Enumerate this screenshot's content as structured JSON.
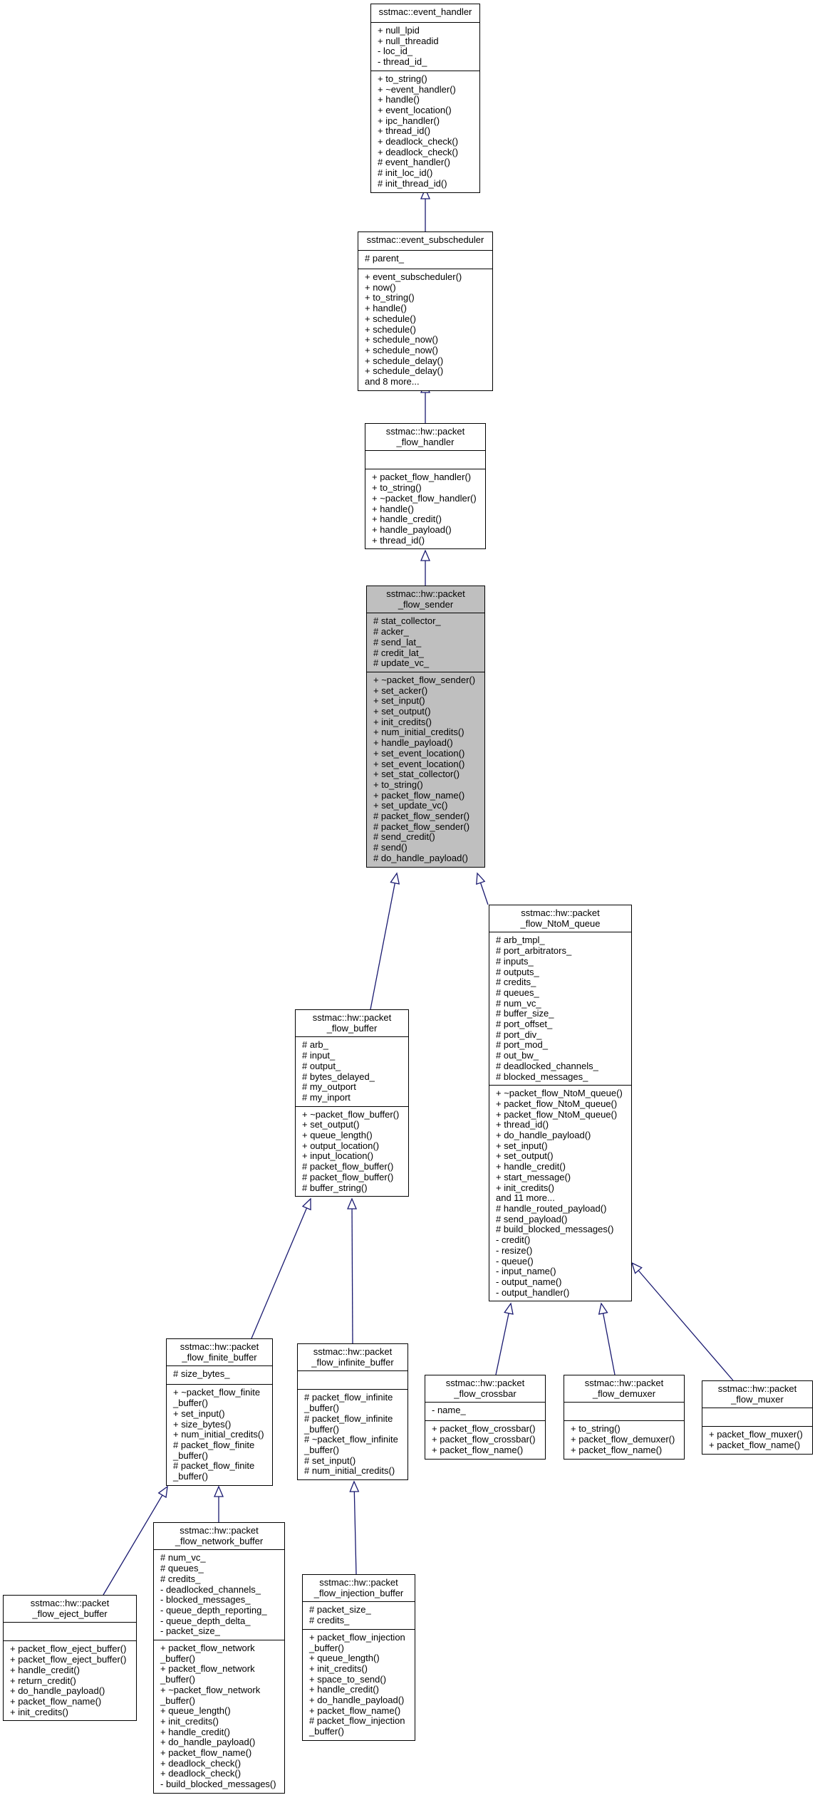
{
  "colors": {
    "edge": "#191970",
    "highlight_fill": "#bfbfbf",
    "box_fill": "#ffffff"
  },
  "classes": [
    {
      "title": [
        "sstmac::event_handler"
      ],
      "attributes": [
        "+ null_lpid",
        "+ null_threadid",
        "- loc_id_",
        "- thread_id_"
      ],
      "methods": [
        "+ to_string()",
        "+ ~event_handler()",
        "+ handle()",
        "+ event_location()",
        "+ ipc_handler()",
        "+ thread_id()",
        "+ deadlock_check()",
        "+ deadlock_check()",
        "# event_handler()",
        "# init_loc_id()",
        "# init_thread_id()"
      ]
    },
    {
      "title": [
        "sstmac::event_subscheduler"
      ],
      "attributes": [
        "# parent_"
      ],
      "methods": [
        "+ event_subscheduler()",
        "+ now()",
        "+ to_string()",
        "+ handle()",
        "+ schedule()",
        "+ schedule()",
        "+ schedule_now()",
        "+ schedule_now()",
        "+ schedule_delay()",
        "+ schedule_delay()",
        "and 8 more..."
      ]
    },
    {
      "title": [
        "sstmac::hw::packet",
        "_flow_handler"
      ],
      "attributes": [],
      "methods": [
        "+ packet_flow_handler()",
        "+ to_string()",
        "+ ~packet_flow_handler()",
        "+ handle()",
        "+ handle_credit()",
        "+ handle_payload()",
        "+ thread_id()"
      ]
    },
    {
      "title": [
        "sstmac::hw::packet",
        "_flow_sender"
      ],
      "highlighted": true,
      "attributes": [
        "# stat_collector_",
        "# acker_",
        "# send_lat_",
        "# credit_lat_",
        "# update_vc_"
      ],
      "methods": [
        "+ ~packet_flow_sender()",
        "+ set_acker()",
        "+ set_input()",
        "+ set_output()",
        "+ init_credits()",
        "+ num_initial_credits()",
        "+ handle_payload()",
        "+ set_event_location()",
        "+ set_event_location()",
        "+ set_stat_collector()",
        "+ to_string()",
        "+ packet_flow_name()",
        "+ set_update_vc()",
        "# packet_flow_sender()",
        "# packet_flow_sender()",
        "# send_credit()",
        "# send()",
        "# do_handle_payload()"
      ]
    },
    {
      "title": [
        "sstmac::hw::packet",
        "_flow_NtoM_queue"
      ],
      "attributes": [
        "# arb_tmpl_",
        "# port_arbitrators_",
        "# inputs_",
        "# outputs_",
        "# credits_",
        "# queues_",
        "# num_vc_",
        "# buffer_size_",
        "# port_offset_",
        "# port_div_",
        "# port_mod_",
        "# out_bw_",
        "# deadlocked_channels_",
        "# blocked_messages_"
      ],
      "methods": [
        "+ ~packet_flow_NtoM_queue()",
        "+ packet_flow_NtoM_queue()",
        "+ packet_flow_NtoM_queue()",
        "+ thread_id()",
        "+ do_handle_payload()",
        "+ set_input()",
        "+ set_output()",
        "+ handle_credit()",
        "+ start_message()",
        "+ init_credits()",
        "and 11 more...",
        "# handle_routed_payload()",
        "# send_payload()",
        "# build_blocked_messages()",
        "- credit()",
        "- resize()",
        "- queue()",
        "- input_name()",
        "- output_name()",
        "- output_handler()"
      ]
    },
    {
      "title": [
        "sstmac::hw::packet",
        "_flow_buffer"
      ],
      "attributes": [
        "# arb_",
        "# input_",
        "# output_",
        "# bytes_delayed_",
        "# my_outport",
        "# my_inport"
      ],
      "methods": [
        "+ ~packet_flow_buffer()",
        "+ set_output()",
        "+ queue_length()",
        "+ output_location()",
        "+ input_location()",
        "# packet_flow_buffer()",
        "# packet_flow_buffer()",
        "# buffer_string()"
      ]
    },
    {
      "title": [
        "sstmac::hw::packet",
        "_flow_finite_buffer"
      ],
      "attributes": [
        "# size_bytes_"
      ],
      "methods": [
        "+ ~packet_flow_finite",
        "_buffer()",
        "+ set_input()",
        "+ size_bytes()",
        "+ num_initial_credits()",
        "# packet_flow_finite",
        "_buffer()",
        "# packet_flow_finite",
        "_buffer()"
      ]
    },
    {
      "title": [
        "sstmac::hw::packet",
        "_flow_infinite_buffer"
      ],
      "attributes": [],
      "methods": [
        "# packet_flow_infinite",
        "_buffer()",
        "# packet_flow_infinite",
        "_buffer()",
        "# ~packet_flow_infinite",
        "_buffer()",
        "# set_input()",
        "# num_initial_credits()"
      ]
    },
    {
      "title": [
        "sstmac::hw::packet",
        "_flow_crossbar"
      ],
      "attributes": [
        "- name_"
      ],
      "methods": [
        "+ packet_flow_crossbar()",
        "+ packet_flow_crossbar()",
        "+ packet_flow_name()"
      ]
    },
    {
      "title": [
        "sstmac::hw::packet",
        "_flow_demuxer"
      ],
      "attributes": [],
      "methods": [
        "+ to_string()",
        "+ packet_flow_demuxer()",
        "+ packet_flow_name()"
      ]
    },
    {
      "title": [
        "sstmac::hw::packet",
        "_flow_muxer"
      ],
      "attributes": [],
      "methods": [
        "+ packet_flow_muxer()",
        "+ packet_flow_name()"
      ]
    },
    {
      "title": [
        "sstmac::hw::packet",
        "_flow_eject_buffer"
      ],
      "attributes": [],
      "methods": [
        "+ packet_flow_eject_buffer()",
        "+ packet_flow_eject_buffer()",
        "+ handle_credit()",
        "+ return_credit()",
        "+ do_handle_payload()",
        "+ packet_flow_name()",
        "+ init_credits()"
      ]
    },
    {
      "title": [
        "sstmac::hw::packet",
        "_flow_network_buffer"
      ],
      "attributes": [
        "# num_vc_",
        "# queues_",
        "# credits_",
        "- deadlocked_channels_",
        "- blocked_messages_",
        "- queue_depth_reporting_",
        "- queue_depth_delta_",
        "- packet_size_"
      ],
      "methods": [
        "+ packet_flow_network",
        "_buffer()",
        "+ packet_flow_network",
        "_buffer()",
        "+ ~packet_flow_network",
        "_buffer()",
        "+ queue_length()",
        "+ init_credits()",
        "+ handle_credit()",
        "+ do_handle_payload()",
        "+ packet_flow_name()",
        "+ deadlock_check()",
        "+ deadlock_check()",
        "- build_blocked_messages()"
      ]
    },
    {
      "title": [
        "sstmac::hw::packet",
        "_flow_injection_buffer"
      ],
      "attributes": [
        "# packet_size_",
        "# credits_"
      ],
      "methods": [
        "+ packet_flow_injection",
        "_buffer()",
        "+ queue_length()",
        "+ init_credits()",
        "+ space_to_send()",
        "+ handle_credit()",
        "+ do_handle_payload()",
        "+ packet_flow_name()",
        "# packet_flow_injection",
        "_buffer()"
      ]
    }
  ]
}
